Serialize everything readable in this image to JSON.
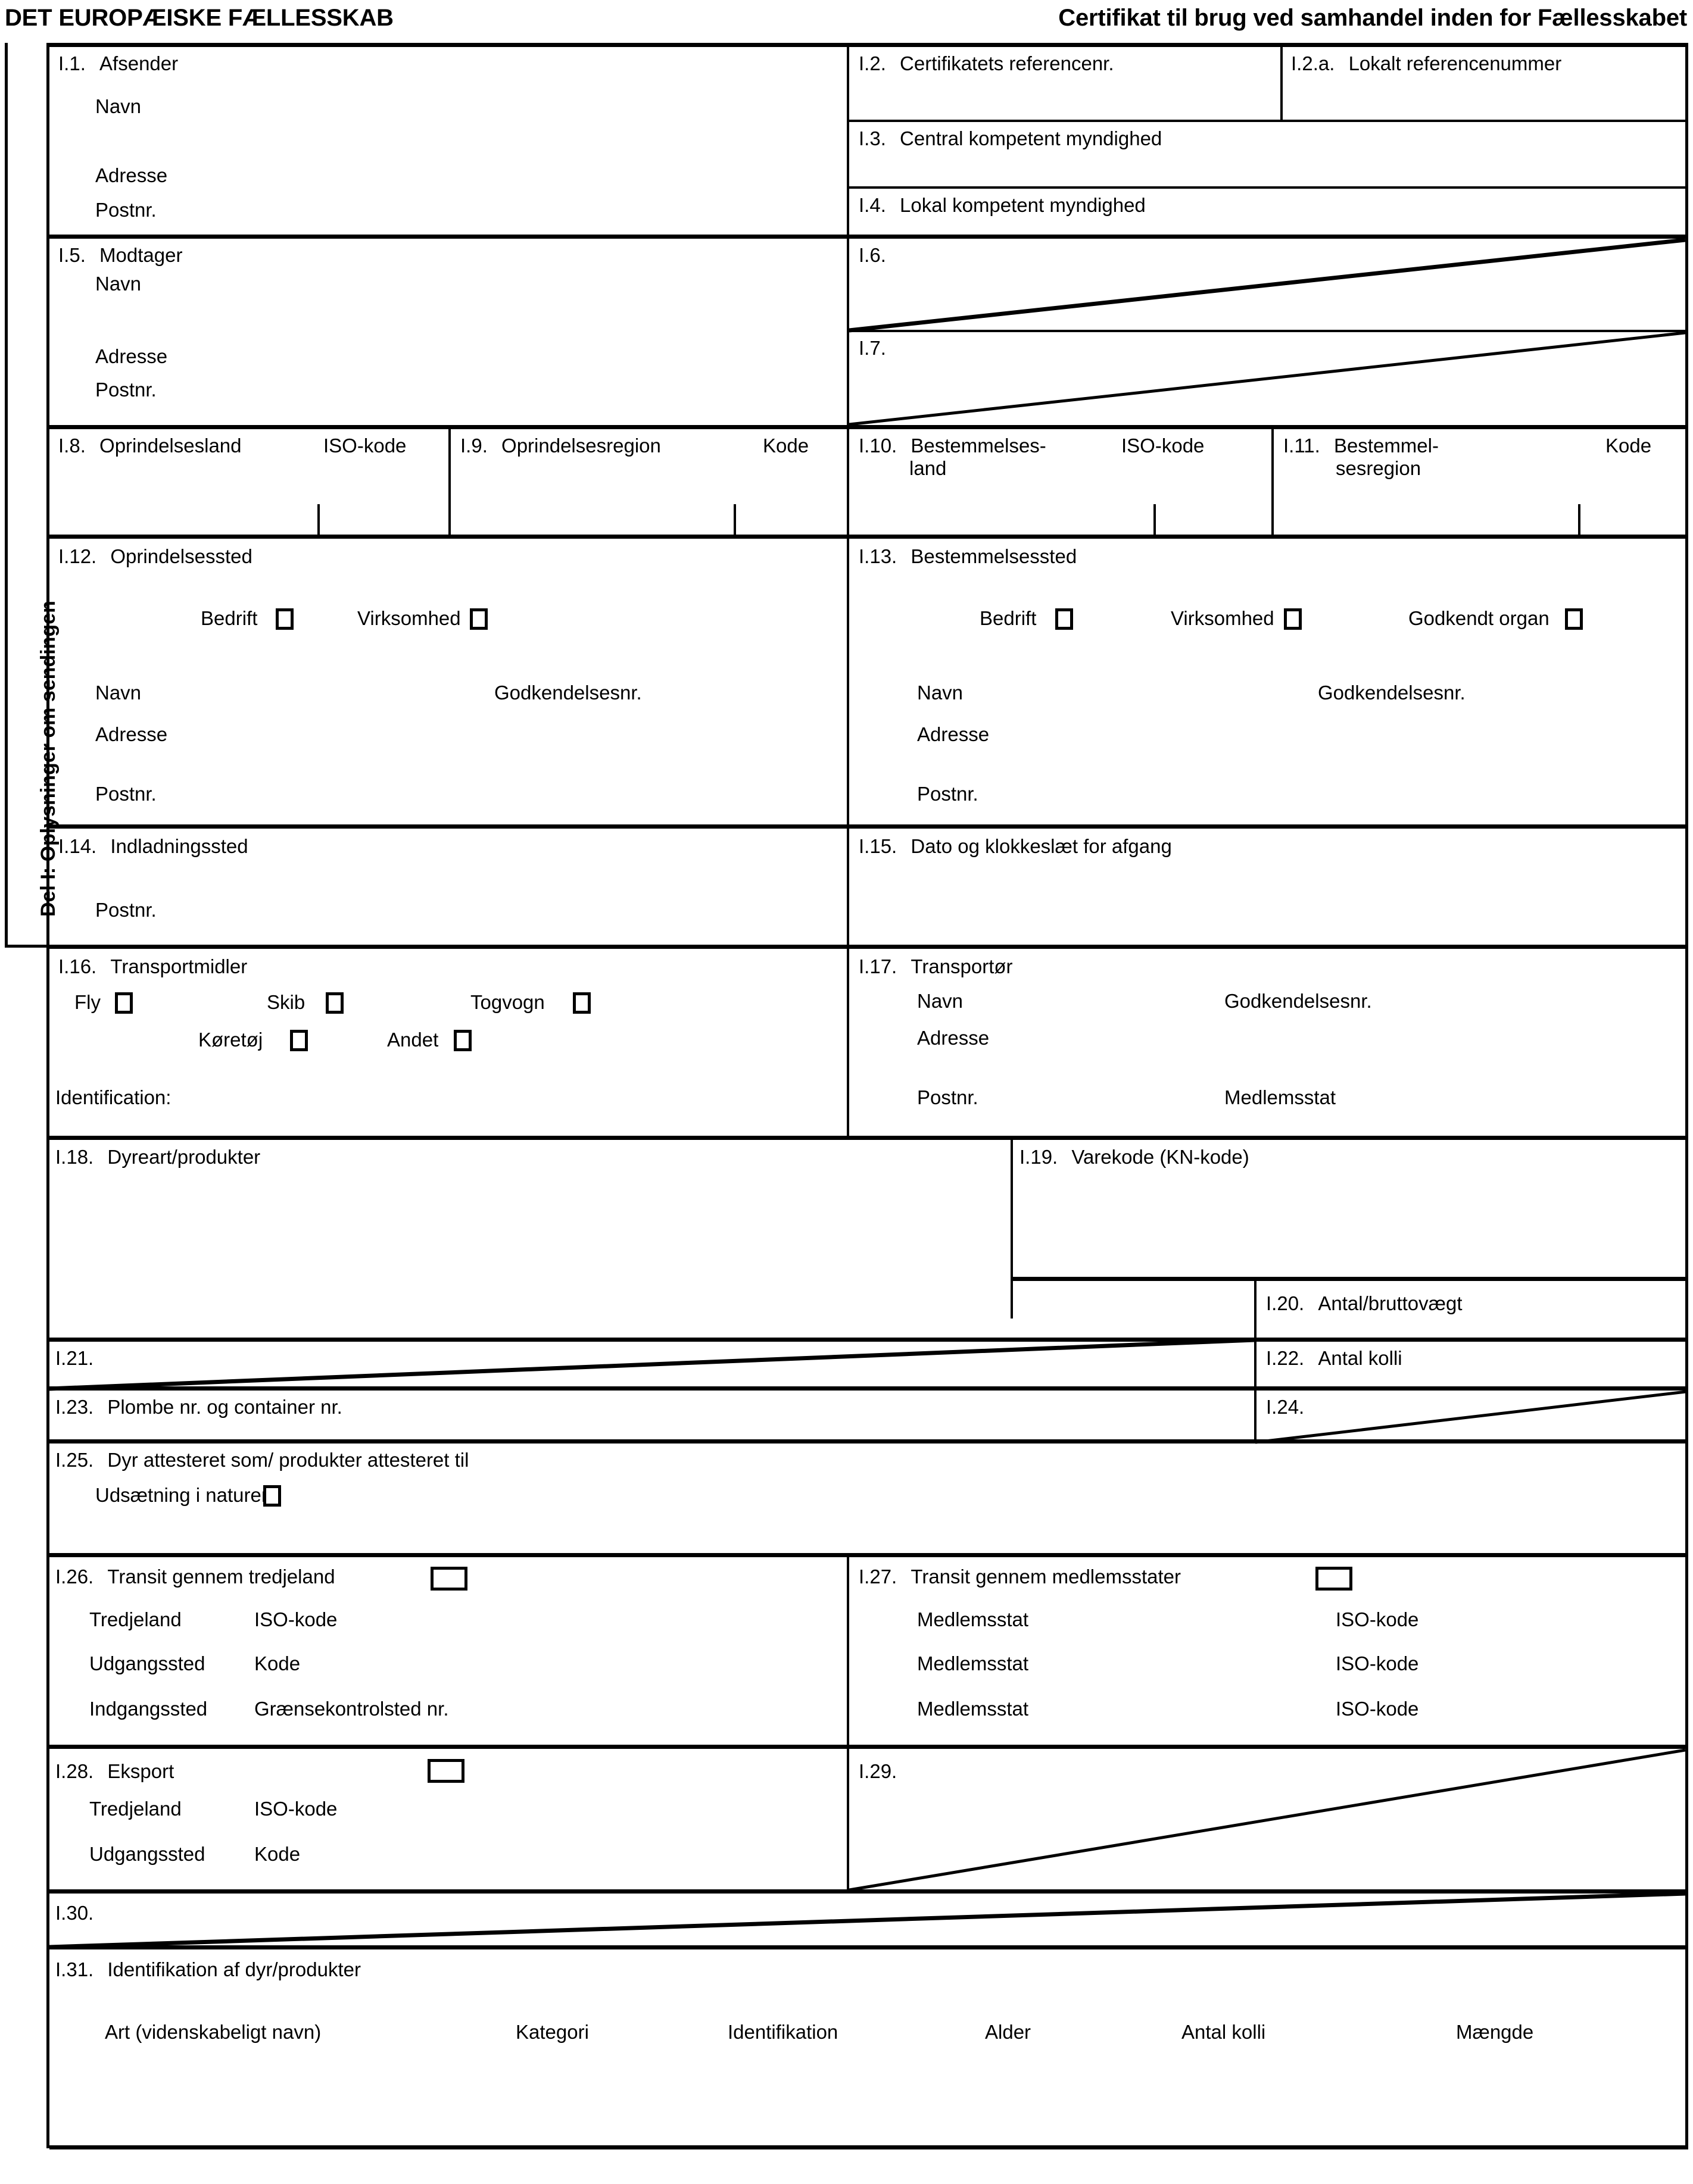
{
  "header": {
    "left": "DET EUROPÆISKE FÆLLESSKAB",
    "right": "Certifikat til brug ved samhandel inden for Fællesskabet"
  },
  "side_label": "Del I: Oplysninger om sendingen",
  "common": {
    "navn": "Navn",
    "adresse": "Adresse",
    "postnr": "Postnr.",
    "godkendelsesnr": "Godkendelsesnr.",
    "iso_kode": "ISO-kode",
    "kode": "Kode",
    "bedrift": "Bedrift",
    "virksomhed": "Virksomhed",
    "godkendt_organ": "Godkendt organ",
    "medlemsstat": "Medlemsstat",
    "tredjeland": "Tredjeland",
    "udgangssted": "Udgangssted",
    "indgangssted": "Indgangssted",
    "graensekontrolsted": "Grænsekontrolsted nr."
  },
  "boxes": {
    "i1": {
      "num": "I.1.",
      "title": "Afsender"
    },
    "i2": {
      "num": "I.2.",
      "title": "Certifikatets referencenr."
    },
    "i2a": {
      "num": "I.2.a.",
      "title": "Lokalt referencenummer"
    },
    "i3": {
      "num": "I.3.",
      "title": "Central kompetent myndighed"
    },
    "i4": {
      "num": "I.4.",
      "title": "Lokal kompetent myndighed"
    },
    "i5": {
      "num": "I.5.",
      "title": "Modtager"
    },
    "i6": {
      "num": "I.6.",
      "title": ""
    },
    "i7": {
      "num": "I.7.",
      "title": ""
    },
    "i8": {
      "num": "I.8.",
      "title": "Oprindelsesland"
    },
    "i9": {
      "num": "I.9.",
      "title": "Oprindelsesregion"
    },
    "i10": {
      "num": "I.10.",
      "title": "Bestemmelses-",
      "title2": "land"
    },
    "i11": {
      "num": "I.11.",
      "title": "Bestemmel-",
      "title2": "sesregion"
    },
    "i12": {
      "num": "I.12.",
      "title": "Oprindelsessted"
    },
    "i13": {
      "num": "I.13.",
      "title": "Bestemmelsessted"
    },
    "i14": {
      "num": "I.14.",
      "title": "Indladningssted"
    },
    "i15": {
      "num": "I.15.",
      "title": "Dato og klokkeslæt for afgang"
    },
    "i16": {
      "num": "I.16.",
      "title": "Transportmidler",
      "fly": "Fly",
      "skib": "Skib",
      "togvogn": "Togvogn",
      "koeretoej": "Køretøj",
      "andet": "Andet",
      "identification": "Identification:"
    },
    "i17": {
      "num": "I.17.",
      "title": "Transportør"
    },
    "i18": {
      "num": "I.18.",
      "title": "Dyreart/produkter"
    },
    "i19": {
      "num": "I.19.",
      "title": "Varekode (KN-kode)"
    },
    "i20": {
      "num": "I.20.",
      "title": "Antal/bruttovægt"
    },
    "i21": {
      "num": "I.21.",
      "title": ""
    },
    "i22": {
      "num": "I.22.",
      "title": "Antal kolli"
    },
    "i23": {
      "num": "I.23.",
      "title": "Plombe nr. og container nr."
    },
    "i24": {
      "num": "I.24.",
      "title": ""
    },
    "i25": {
      "num": "I.25.",
      "title": "Dyr attesteret som/ produkter attesteret til",
      "udsaetning": "Udsætning i naturen"
    },
    "i26": {
      "num": "I.26.",
      "title": "Transit gennem tredjeland"
    },
    "i27": {
      "num": "I.27.",
      "title": "Transit gennem medlemsstater"
    },
    "i28": {
      "num": "I.28.",
      "title": "Eksport"
    },
    "i29": {
      "num": "I.29.",
      "title": ""
    },
    "i30": {
      "num": "I.30.",
      "title": ""
    },
    "i31": {
      "num": "I.31.",
      "title": "Identifikation af dyr/produkter",
      "columns": [
        "Art (videnskabeligt navn)",
        "Kategori",
        "Identifikation",
        "Alder",
        "Antal kolli",
        "Mængde"
      ]
    }
  }
}
